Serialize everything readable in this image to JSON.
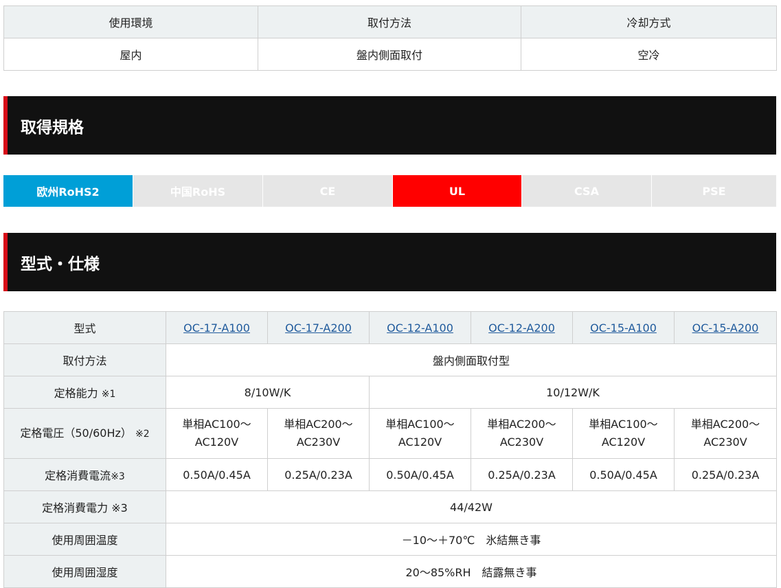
{
  "env": {
    "headers": [
      "使用環境",
      "取付方法",
      "冷却方式"
    ],
    "values": [
      "屋内",
      "盤内側面取付",
      "空冷"
    ]
  },
  "sections": {
    "certifications": "取得規格",
    "specs": "型式・仕様"
  },
  "certifications": [
    {
      "label": "欧州RoHS2",
      "state": "active",
      "color": "#009fd7"
    },
    {
      "label": "中国RoHS",
      "state": "inactive",
      "color": "#e6e6e6"
    },
    {
      "label": "CE",
      "state": "inactive",
      "color": "#e6e6e6"
    },
    {
      "label": "UL",
      "state": "active",
      "color": "#ff0000"
    },
    {
      "label": "CSA",
      "state": "inactive",
      "color": "#e6e6e6"
    },
    {
      "label": "PSE",
      "state": "inactive",
      "color": "#e6e6e6"
    }
  ],
  "spec": {
    "model_label": "型式",
    "models": [
      "OC-17-A100",
      "OC-17-A200",
      "OC-12-A100",
      "OC-12-A200",
      "OC-15-A100",
      "OC-15-A200"
    ],
    "mount_label": "取付方法",
    "mount_value": "盤内側面取付型",
    "capacity_label": "定格能力",
    "capacity_note": "※1",
    "capacity_values": [
      "8/10W/K",
      "10/12W/K"
    ],
    "voltage_label": "定格電圧（50/60Hz）",
    "voltage_note": "※2",
    "voltage_values": [
      {
        "line1": "単相AC100～",
        "line2": "AC120V"
      },
      {
        "line1": "単相AC200～",
        "line2": "AC230V"
      },
      {
        "line1": "単相AC100～",
        "line2": "AC120V"
      },
      {
        "line1": "単相AC200～",
        "line2": "AC230V"
      },
      {
        "line1": "単相AC100～",
        "line2": "AC120V"
      },
      {
        "line1": "単相AC200～",
        "line2": "AC230V"
      }
    ],
    "current_label": "定格消費電流",
    "current_note": "※3",
    "current_values": [
      "0.50A/0.45A",
      "0.25A/0.23A",
      "0.50A/0.45A",
      "0.25A/0.23A",
      "0.50A/0.45A",
      "0.25A/0.23A"
    ],
    "power_label": "定格消費電力",
    "power_note": "※3",
    "power_value": "44/42W",
    "temp_label": "使用周囲温度",
    "temp_value": "－10～＋70℃　氷結無き事",
    "humidity_label": "使用周囲湿度",
    "humidity_value": "20～85%RH　結露無き事"
  }
}
